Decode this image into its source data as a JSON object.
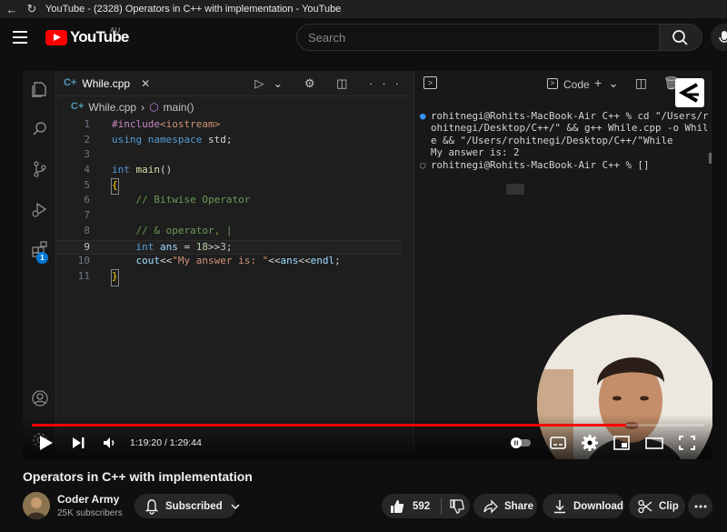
{
  "browser": {
    "title": "YouTube - (2328) Operators in C++ with implementation - YouTube"
  },
  "header": {
    "logo_text": "YouTube",
    "country_code": "AU",
    "search_placeholder": "Search"
  },
  "editor": {
    "tab_label": "While.cpp",
    "breadcrumb_file": "While.cpp",
    "breadcrumb_symbol": "main()",
    "code_lines": [
      {
        "n": "1",
        "text": "#include<iostream>"
      },
      {
        "n": "2",
        "text": "using namespace std;"
      },
      {
        "n": "3",
        "text": ""
      },
      {
        "n": "4",
        "text": "int main()"
      },
      {
        "n": "5",
        "text": "{"
      },
      {
        "n": "6",
        "text": "    // Bitwise Operator"
      },
      {
        "n": "7",
        "text": ""
      },
      {
        "n": "8",
        "text": "    // & operator, |"
      },
      {
        "n": "9",
        "text": "    int ans = 18>>3;"
      },
      {
        "n": "10",
        "text": "    cout<<\"My answer is: \"<<ans<<endl;"
      },
      {
        "n": "11",
        "text": "}"
      }
    ],
    "extensions_badge": "1"
  },
  "terminal": {
    "tab_label": "Code",
    "lines": [
      "rohitnegi@Rohits-MacBook-Air C++ % cd \"/Users/r",
      "ohitnegi/Desktop/C++/\" && g++ While.cpp -o Whil",
      "e && \"/Users/rohitnegi/Desktop/C++/\"While",
      "My answer is: 2",
      "rohitnegi@Rohits-MacBook-Air C++ % []"
    ]
  },
  "player": {
    "current_time": "1:19:20",
    "duration": "1:29:44",
    "time_display": "1:19:20 / 1:29:44",
    "progress_fraction": 0.884
  },
  "video": {
    "title": "Operators in C++ with implementation",
    "channel_name": "Coder Army",
    "subscribers": "25K subscribers",
    "subscribe_label": "Subscribed",
    "likes": "592",
    "share_label": "Share",
    "download_label": "Download",
    "clip_label": "Clip"
  },
  "colors": {
    "accent": "#ff0000",
    "vscode_blue": "#569cd6",
    "string": "#ce9178",
    "comment": "#6a9955"
  }
}
